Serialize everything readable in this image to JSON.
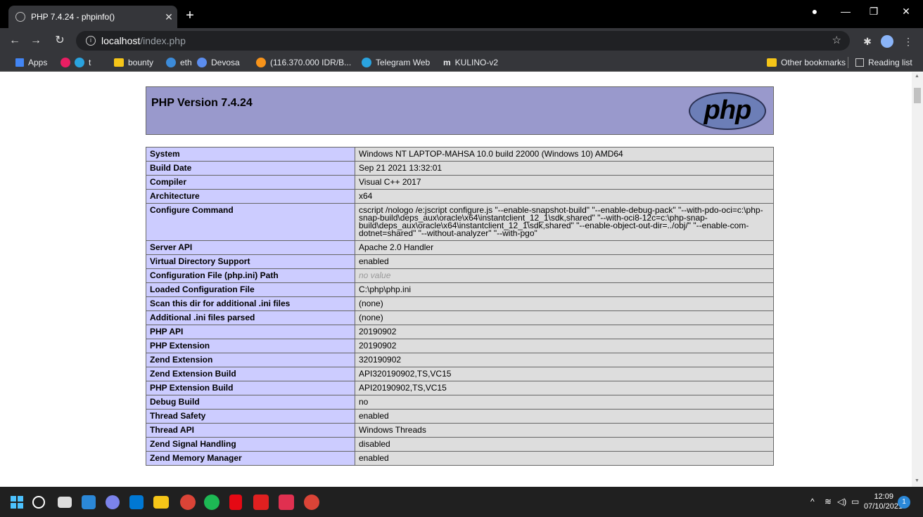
{
  "browser": {
    "tab_title": "PHP 7.4.24 - phpinfo()",
    "url_host": "localhost",
    "url_path": "/index.php",
    "bookmarks": [
      {
        "label": "Apps",
        "color": "#4285f4"
      },
      {
        "label": "",
        "color": "#e91e63"
      },
      {
        "label": "t",
        "color": "#2aa3df"
      },
      {
        "label": "bounty",
        "color": "#f5c518"
      },
      {
        "label": "eth",
        "color": "#3c8bd9"
      },
      {
        "label": "Devosa",
        "color": "#5b8def"
      },
      {
        "label": "(116.370.000 IDR/B...",
        "color": "#f7931a"
      },
      {
        "label": "Telegram Web",
        "color": "#2aa3df"
      },
      {
        "label": "KULINO-v2",
        "color": "#000000"
      }
    ],
    "other_bookmarks": "Other bookmarks",
    "reading_list": "Reading list"
  },
  "phpinfo": {
    "title": "PHP Version 7.4.24",
    "logo_text": "php",
    "rows": [
      {
        "key": "System",
        "value": "Windows NT LAPTOP-MAHSA 10.0 build 22000 (Windows 10) AMD64"
      },
      {
        "key": "Build Date",
        "value": "Sep 21 2021 13:32:01"
      },
      {
        "key": "Compiler",
        "value": "Visual C++ 2017"
      },
      {
        "key": "Architecture",
        "value": "x64"
      },
      {
        "key": "Configure Command",
        "value": "cscript /nologo /e:jscript configure.js \"--enable-snapshot-build\" \"--enable-debug-pack\" \"--with-pdo-oci=c:\\php-snap-build\\deps_aux\\oracle\\x64\\instantclient_12_1\\sdk,shared\" \"--with-oci8-12c=c:\\php-snap-build\\deps_aux\\oracle\\x64\\instantclient_12_1\\sdk,shared\" \"--enable-object-out-dir=../obj/\" \"--enable-com-dotnet=shared\" \"--without-analyzer\" \"--with-pgo\""
      },
      {
        "key": "Server API",
        "value": "Apache 2.0 Handler"
      },
      {
        "key": "Virtual Directory Support",
        "value": "enabled"
      },
      {
        "key": "Configuration File (php.ini) Path",
        "value": "no value",
        "novalue": true
      },
      {
        "key": "Loaded Configuration File",
        "value": "C:\\php\\php.ini"
      },
      {
        "key": "Scan this dir for additional .ini files",
        "value": "(none)"
      },
      {
        "key": "Additional .ini files parsed",
        "value": "(none)"
      },
      {
        "key": "PHP API",
        "value": "20190902"
      },
      {
        "key": "PHP Extension",
        "value": "20190902"
      },
      {
        "key": "Zend Extension",
        "value": "320190902"
      },
      {
        "key": "Zend Extension Build",
        "value": "API320190902,TS,VC15"
      },
      {
        "key": "PHP Extension Build",
        "value": "API20190902,TS,VC15"
      },
      {
        "key": "Debug Build",
        "value": "no"
      },
      {
        "key": "Thread Safety",
        "value": "enabled"
      },
      {
        "key": "Thread API",
        "value": "Windows Threads"
      },
      {
        "key": "Zend Signal Handling",
        "value": "disabled"
      },
      {
        "key": "Zend Memory Manager",
        "value": "enabled"
      }
    ]
  },
  "taskbar": {
    "time": "12:09",
    "date": "07/10/2021",
    "notifications": "1"
  }
}
